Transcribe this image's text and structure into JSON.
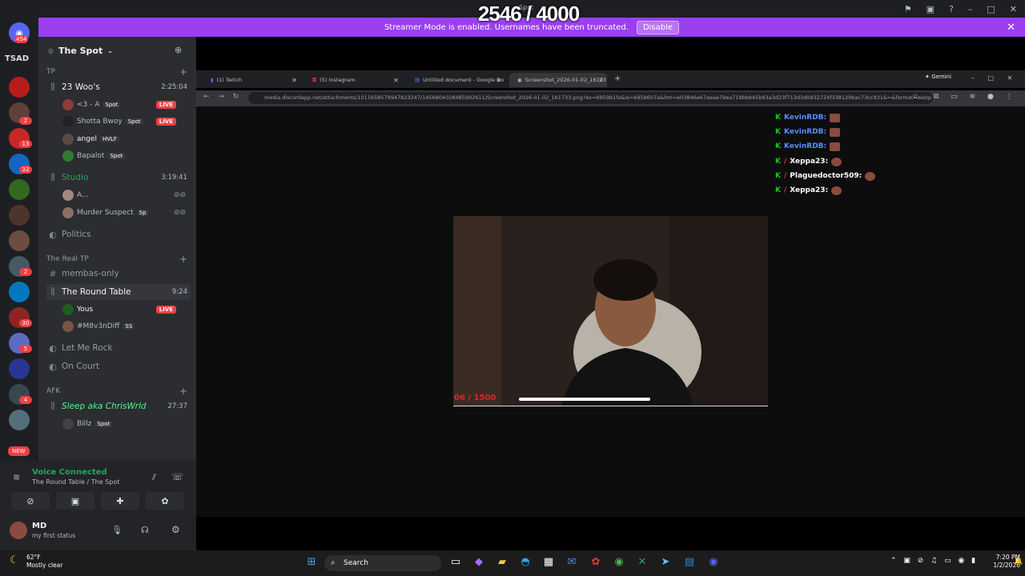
{
  "overlay": {
    "counter": "2546 / 4000",
    "app_label": "Spot"
  },
  "banner": {
    "text": "Streamer Mode is enabled. Usernames have been truncated.",
    "button": "Disable"
  },
  "rail": {
    "home_badge": "454",
    "tsad": "TSAD",
    "badges": [
      "2",
      "13",
      "32",
      "2",
      "30",
      "5",
      "4"
    ],
    "new_label": "NEW"
  },
  "server": {
    "name": "The Spot"
  },
  "categories": {
    "tp": "TP",
    "real_tp": "The Real TP",
    "afk": "AFK"
  },
  "channels": [
    {
      "name": "23 Woo's",
      "time": "2:25:04"
    },
    {
      "name": "Studio",
      "time": "3:19:41"
    },
    {
      "name": "Politics"
    },
    {
      "name": "membas-only"
    },
    {
      "name": "The Round Table",
      "time": "9:24"
    },
    {
      "name": "Let Me Rock"
    },
    {
      "name": "On Court"
    },
    {
      "name": "Sleep aka ChrisWrld",
      "time": "27:37"
    }
  ],
  "users": [
    {
      "name": "<3 - A",
      "tag": "Spot",
      "live": "LIVE"
    },
    {
      "name": "Shotta Bwoy",
      "tag": "Spot",
      "live": "LIVE"
    },
    {
      "name": "angel",
      "tag": "HVLF"
    },
    {
      "name": "Bapalot",
      "tag": "Spot"
    },
    {
      "name": "A..."
    },
    {
      "name": "Murder Suspect",
      "tag": "Sp"
    },
    {
      "name": "Yous",
      "live": "LIVE"
    },
    {
      "name": "#M8v3nDiff",
      "tag": "SS"
    },
    {
      "name": "Billz",
      "tag": "Spot"
    }
  ],
  "voice": {
    "status": "Voice Connected",
    "location": "The Round Table / The Spot"
  },
  "me": {
    "name": "MD",
    "status": "my first status"
  },
  "browser": {
    "tabs": [
      "(1) Twitch",
      "(5) Instagram",
      "Untitled document - Google Do",
      "Screenshot_2026-01-02_16173"
    ],
    "url": "media.discordapp.net/attachments/1011658579947823247/1456804028485992611/Screenshot_2026-01-02_161733.png?ex=6959b1fa&is=6958607a&hm=e03846e67aeae79ea719bbb45b63a3d23f713d3d0d32724f338129bac73cc931&=&format=webp",
    "gemini": "Gemini"
  },
  "chat": [
    {
      "user": "KevinRDB:",
      "color": "#5a8cff"
    },
    {
      "user": "KevinRDB:",
      "color": "#5a8cff"
    },
    {
      "user": "KevinRDB:",
      "color": "#5a8cff"
    },
    {
      "user": "Xeppa23:",
      "color": "#ffffff"
    },
    {
      "user": "Plaguedoctor509:",
      "color": "#ffffff"
    },
    {
      "user": "Xeppa23:",
      "color": "#ffffff"
    }
  ],
  "video": {
    "counter": "06 / 1500"
  },
  "taskbar": {
    "temp": "62°F",
    "weather": "Mostly clear",
    "search": "Search",
    "time": "7:20 PM",
    "date": "1/2/2026"
  }
}
